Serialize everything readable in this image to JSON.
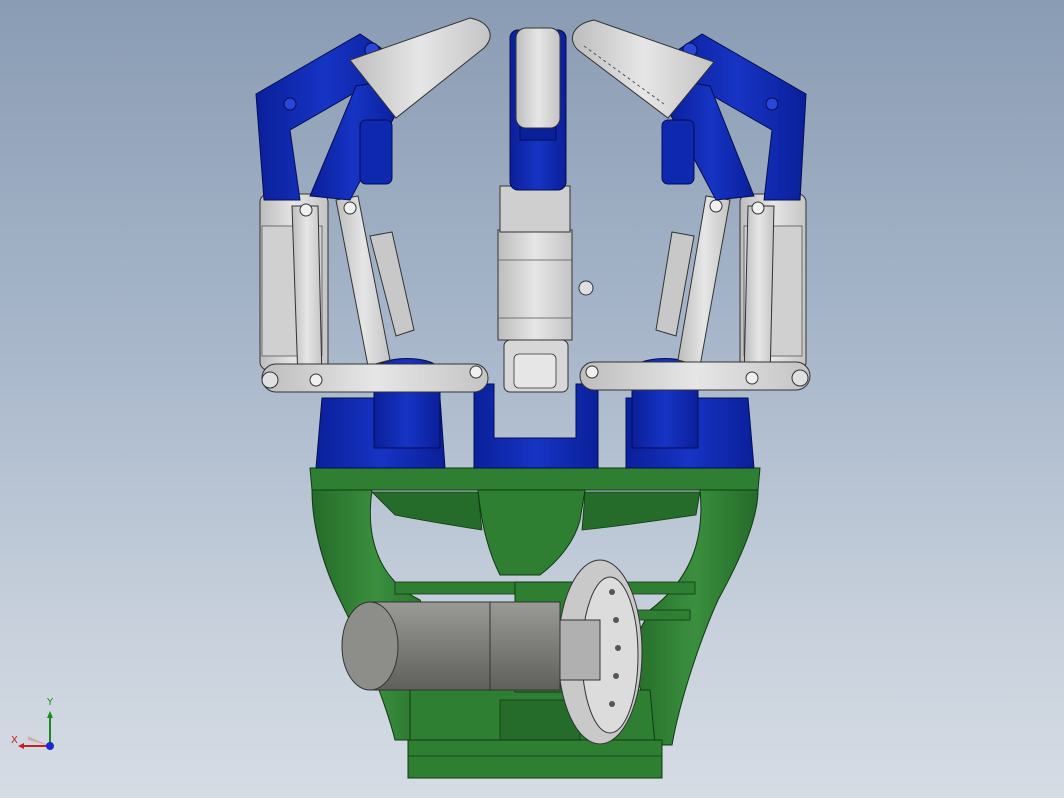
{
  "viewport": {
    "background_top": "#8a9cb4",
    "background_bottom": "#d6dce4"
  },
  "model": {
    "description_colors": {
      "blue_parts": "#0a22a8",
      "gray_parts": "#d9d9d9",
      "green_base": "#2e7d32",
      "motor": "#8c8c8c"
    }
  },
  "triad": {
    "x_label": "X",
    "y_label": "Y",
    "x_color": "#c42020",
    "y_color": "#1a8a1a",
    "z_color": "#1a2ad0"
  }
}
